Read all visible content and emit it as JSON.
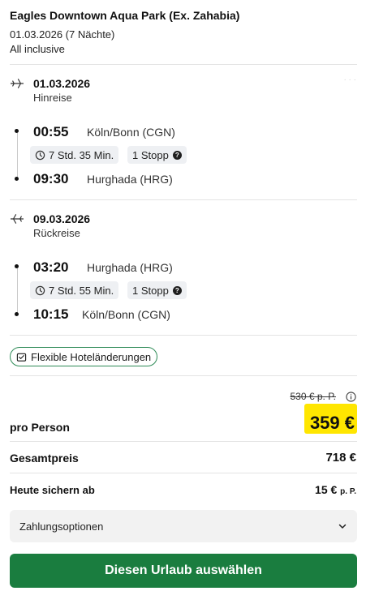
{
  "hotel": {
    "name": "Eagles Downtown Aqua Park (Ex. Zahabia)",
    "dates": "01.03.2026 (7 Nächte)",
    "board": "All inclusive"
  },
  "outbound": {
    "date": "01.03.2026",
    "label": "Hinreise",
    "departure": {
      "time": "00:55",
      "airport": "Köln/Bonn (CGN)"
    },
    "duration": "7 Std. 35 Min.",
    "stops": "1 Stopp",
    "arrival": {
      "time": "09:30",
      "airport": "Hurghada (HRG)"
    }
  },
  "return": {
    "date": "09.03.2026",
    "label": "Rückreise",
    "departure": {
      "time": "03:20",
      "airport": "Hurghada (HRG)"
    },
    "duration": "7 Std. 55 Min.",
    "stops": "1 Stopp",
    "arrival": {
      "time": "10:15",
      "airport": "Köln/Bonn (CGN)"
    }
  },
  "flex_badge": "Flexible Hoteländerungen",
  "pricing": {
    "old_price": "530 € p. P.",
    "per_person_label": "pro Person",
    "per_person_price": "359 €",
    "total_label": "Gesamtpreis",
    "total_price": "718 €",
    "deposit_label": "Heute sichern ab",
    "deposit_price": "15 €",
    "deposit_unit": "p. P."
  },
  "payment_options": "Zahlungsoptionen",
  "cta_label": "Diesen Urlaub auswählen",
  "colors": {
    "accent": "#1a7d3f",
    "highlight": "#ffe600",
    "badge_border": "#2e8b57"
  },
  "icons": [
    "plane-departure-icon",
    "plane-arrival-icon",
    "clock-icon",
    "question-icon",
    "hotel-change-icon",
    "info-icon",
    "chevron-down-icon"
  ]
}
